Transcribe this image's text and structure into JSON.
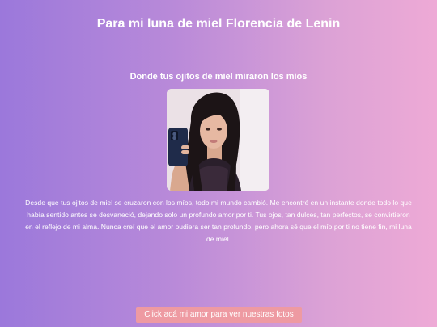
{
  "page": {
    "title": "Para mi luna de miel Florencia de Lenin",
    "subtitle": "Donde tus ojitos de miel miraron los míos",
    "photo_icon": "portrait-photo",
    "message": "Desde que tus ojitos de miel se cruzaron con los míos, todo mi mundo cambió. Me encontré en un instante donde todo lo que había sentido antes se desvaneció, dejando solo un profundo amor por ti. Tus ojos, tan dulces, tan perfectos, se convirtieron en el reflejo de mi alma. Nunca creí que el amor pudiera ser tan profundo, pero ahora sé que el mío por ti no tiene fin, mi luna de miel.",
    "button_label": "Click acá mi amor para ver nuestras fotos"
  },
  "colors": {
    "gradient_start": "#9b78db",
    "gradient_end": "#eeaad6",
    "button_bg": "#ee9aa2",
    "text": "#ffffff"
  }
}
